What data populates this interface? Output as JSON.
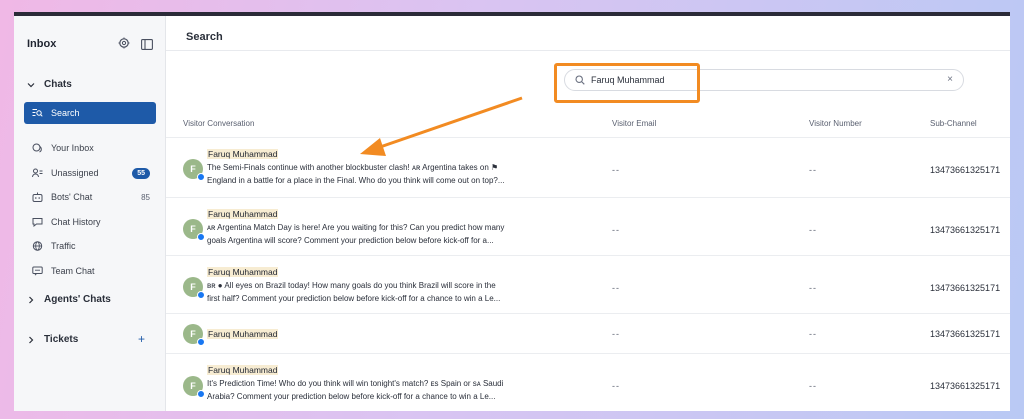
{
  "sidebar": {
    "title": "Inbox",
    "chats_section": "Chats",
    "items": [
      {
        "label": "Search"
      },
      {
        "label": "Your Inbox"
      },
      {
        "label": "Unassigned",
        "badge": "55"
      },
      {
        "label": "Bots' Chat",
        "count": "85"
      },
      {
        "label": "Chat History"
      },
      {
        "label": "Traffic"
      },
      {
        "label": "Team Chat"
      }
    ],
    "agents_section": "Agents' Chats",
    "tickets_section": "Tickets",
    "tickets_add": "+"
  },
  "main": {
    "title": "Search",
    "search": {
      "value": "Faruq Muhammad",
      "clear": "×"
    },
    "columns": [
      "Visitor Conversation",
      "Visitor Email",
      "Visitor Number",
      "Sub-Channel"
    ],
    "rows": [
      {
        "avatar": "F",
        "name": "Faruq Muhammad",
        "line1": "The Semi-Finals continue with another blockbuster clash! ᴀʀ Argentina takes on ⚑",
        "line2": "England in a battle for a place in the Final. Who do you think will come out on top?...",
        "email": "--",
        "number": "--",
        "sub": "13473661325171"
      },
      {
        "avatar": "F",
        "name": "Faruq Muhammad",
        "line1": "ᴀʀ Argentina Match Day is here! Are you waiting for this? Can you predict how many",
        "line2": "goals Argentina will score? Comment your prediction below before kick-off for a...",
        "email": "--",
        "number": "--",
        "sub": "13473661325171"
      },
      {
        "avatar": "F",
        "name": "Faruq Muhammad",
        "line1": "ʙʀ ● All eyes on Brazil today! How many goals do you think Brazil will score in the",
        "line2": "first half? Comment your prediction below before kick-off for a chance to win a Le...",
        "email": "--",
        "number": "--",
        "sub": "13473661325171"
      },
      {
        "avatar": "F",
        "name": "Faruq Muhammad",
        "line1": "",
        "line2": "",
        "email": "--",
        "number": "--",
        "sub": "13473661325171"
      },
      {
        "avatar": "F",
        "name": "Faruq Muhammad",
        "line1": "It's Prediction Time! Who do you think will win tonight's match? ᴇs Spain or sᴀ Saudi",
        "line2": "Arabia? Comment your prediction below before kick-off for a chance to win a Le...",
        "email": "--",
        "number": "--",
        "sub": "13473661325171"
      }
    ]
  },
  "colors": {
    "accent": "#1e5aa8",
    "highlight": "#f28b22",
    "facebook": "#1877f2"
  }
}
